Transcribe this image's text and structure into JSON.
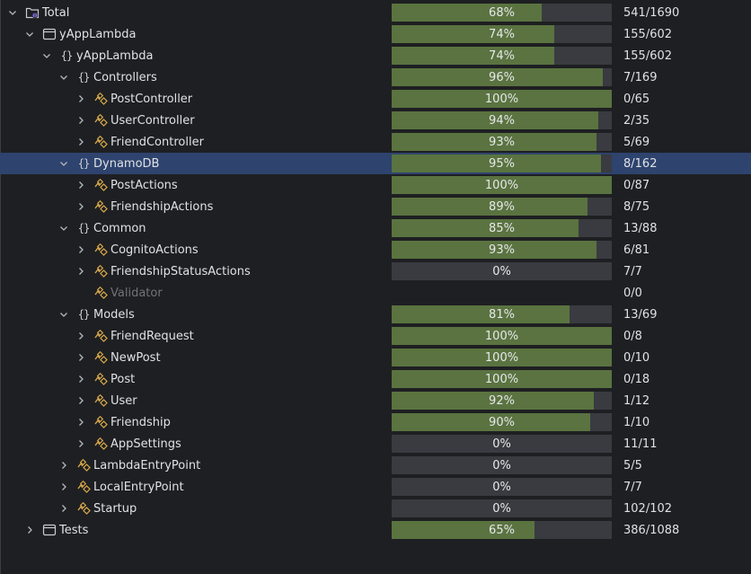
{
  "colors": {
    "background": "#1e1f22",
    "selection": "#2e436e",
    "bar_track": "#393b40",
    "bar_fill": "#5a7340",
    "class_icon": "#d6a84a",
    "text": "#dfe1e5",
    "text_dim": "#6f737a"
  },
  "rows": [
    {
      "name": "Total",
      "icon": "project-chart-icon",
      "depth": 0,
      "expander": "expanded",
      "percent": "68%",
      "fraction": 0.68,
      "count": "541/1690",
      "selected": false
    },
    {
      "name": "yAppLambda",
      "icon": "module-icon",
      "depth": 1,
      "expander": "expanded",
      "percent": "74%",
      "fraction": 0.74,
      "count": "155/602",
      "selected": false
    },
    {
      "name": "yAppLambda",
      "icon": "namespace-icon",
      "depth": 2,
      "expander": "expanded",
      "percent": "74%",
      "fraction": 0.74,
      "count": "155/602",
      "selected": false
    },
    {
      "name": "Controllers",
      "icon": "namespace-icon",
      "depth": 3,
      "expander": "expanded",
      "percent": "96%",
      "fraction": 0.96,
      "count": "7/169",
      "selected": false
    },
    {
      "name": "PostController",
      "icon": "class-icon",
      "depth": 4,
      "expander": "collapsed",
      "percent": "100%",
      "fraction": 1.0,
      "count": "0/65",
      "selected": false
    },
    {
      "name": "UserController",
      "icon": "class-icon",
      "depth": 4,
      "expander": "collapsed",
      "percent": "94%",
      "fraction": 0.94,
      "count": "2/35",
      "selected": false
    },
    {
      "name": "FriendController",
      "icon": "class-icon",
      "depth": 4,
      "expander": "collapsed",
      "percent": "93%",
      "fraction": 0.93,
      "count": "5/69",
      "selected": false
    },
    {
      "name": "DynamoDB",
      "icon": "namespace-icon",
      "depth": 3,
      "expander": "expanded",
      "percent": "95%",
      "fraction": 0.95,
      "count": "8/162",
      "selected": true
    },
    {
      "name": "PostActions",
      "icon": "class-icon",
      "depth": 4,
      "expander": "collapsed",
      "percent": "100%",
      "fraction": 1.0,
      "count": "0/87",
      "selected": false
    },
    {
      "name": "FriendshipActions",
      "icon": "class-icon",
      "depth": 4,
      "expander": "collapsed",
      "percent": "89%",
      "fraction": 0.89,
      "count": "8/75",
      "selected": false
    },
    {
      "name": "Common",
      "icon": "namespace-icon",
      "depth": 3,
      "expander": "expanded",
      "percent": "85%",
      "fraction": 0.85,
      "count": "13/88",
      "selected": false
    },
    {
      "name": "CognitoActions",
      "icon": "class-icon",
      "depth": 4,
      "expander": "collapsed",
      "percent": "93%",
      "fraction": 0.93,
      "count": "6/81",
      "selected": false
    },
    {
      "name": "FriendshipStatusActions",
      "icon": "class-icon",
      "depth": 4,
      "expander": "collapsed",
      "percent": "0%",
      "fraction": 0.0,
      "count": "7/7",
      "selected": false
    },
    {
      "name": "Validator",
      "icon": "class-icon",
      "depth": 4,
      "expander": "none",
      "percent": "",
      "fraction": null,
      "count": "0/0",
      "selected": false,
      "dim": true
    },
    {
      "name": "Models",
      "icon": "namespace-icon",
      "depth": 3,
      "expander": "expanded",
      "percent": "81%",
      "fraction": 0.81,
      "count": "13/69",
      "selected": false
    },
    {
      "name": "FriendRequest",
      "icon": "class-icon",
      "depth": 4,
      "expander": "collapsed",
      "percent": "100%",
      "fraction": 1.0,
      "count": "0/8",
      "selected": false
    },
    {
      "name": "NewPost",
      "icon": "class-icon",
      "depth": 4,
      "expander": "collapsed",
      "percent": "100%",
      "fraction": 1.0,
      "count": "0/10",
      "selected": false
    },
    {
      "name": "Post",
      "icon": "class-icon",
      "depth": 4,
      "expander": "collapsed",
      "percent": "100%",
      "fraction": 1.0,
      "count": "0/18",
      "selected": false
    },
    {
      "name": "User",
      "icon": "class-icon",
      "depth": 4,
      "expander": "collapsed",
      "percent": "92%",
      "fraction": 0.92,
      "count": "1/12",
      "selected": false
    },
    {
      "name": "Friendship",
      "icon": "class-icon",
      "depth": 4,
      "expander": "collapsed",
      "percent": "90%",
      "fraction": 0.9,
      "count": "1/10",
      "selected": false
    },
    {
      "name": "AppSettings",
      "icon": "class-icon",
      "depth": 4,
      "expander": "collapsed",
      "percent": "0%",
      "fraction": 0.0,
      "count": "11/11",
      "selected": false
    },
    {
      "name": "LambdaEntryPoint",
      "icon": "class-icon",
      "depth": 3,
      "expander": "collapsed",
      "percent": "0%",
      "fraction": 0.0,
      "count": "5/5",
      "selected": false
    },
    {
      "name": "LocalEntryPoint",
      "icon": "class-icon",
      "depth": 3,
      "expander": "collapsed",
      "percent": "0%",
      "fraction": 0.0,
      "count": "7/7",
      "selected": false
    },
    {
      "name": "Startup",
      "icon": "class-icon",
      "depth": 3,
      "expander": "collapsed",
      "percent": "0%",
      "fraction": 0.0,
      "count": "102/102",
      "selected": false
    },
    {
      "name": "Tests",
      "icon": "module-icon",
      "depth": 1,
      "expander": "collapsed",
      "percent": "65%",
      "fraction": 0.65,
      "count": "386/1088",
      "selected": false
    }
  ]
}
